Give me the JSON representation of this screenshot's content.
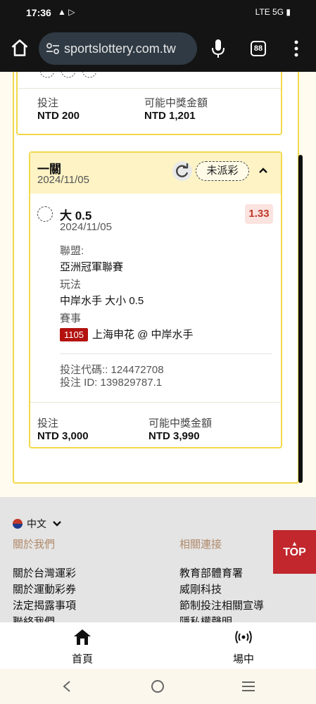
{
  "status_bar": {
    "time": "17:36",
    "left_icons": "▲ ▷",
    "right_icons": "LTE 5G ▮"
  },
  "browser": {
    "url": "sportslottery.com.tw",
    "tab_count": "88"
  },
  "card_prev": {
    "stake_label": "投注",
    "stake_value": "NTD 200",
    "win_label": "可能中獎金額",
    "win_value": "NTD 1,201"
  },
  "bet": {
    "type": "一關",
    "date": "2024/11/05",
    "status": "未派彩",
    "selection": "大 0.5",
    "selection_date": "2024/11/05",
    "odds": "1.33",
    "league_label": "聯盟:",
    "league_value": "亞洲冠軍聯賽",
    "play_label": "玩法",
    "play_value": "中岸水手 大小 0.5",
    "match_label": "賽事",
    "match_id": "1105",
    "match_value": "上海申花 @ 中岸水手",
    "bet_code": "投注代碼:: 124472708",
    "bet_id": "投注 ID: 139829787.1",
    "stake_label": "投注",
    "stake_value": "NTD 3,000",
    "win_label": "可能中獎金額",
    "win_value": "NTD 3,990"
  },
  "footer": {
    "language": "中文",
    "col1_title": "關於我們",
    "col1_items": [
      "關於台灣運彩",
      "關於運動彩券",
      "法定揭露事項",
      "聯絡我們"
    ],
    "col2_title": "相關連接",
    "col2_items": [
      "教育部體育署",
      "威剛科技",
      "節制投注相關宣導",
      "隱私權聲明"
    ],
    "top_label": "TOP"
  },
  "tabbar": {
    "home": "首頁",
    "live": "場中"
  },
  "colors": {
    "accent_yellow": "#f2d94a",
    "brand_red": "#c1272d",
    "header_bg": "#fdf3c5"
  }
}
